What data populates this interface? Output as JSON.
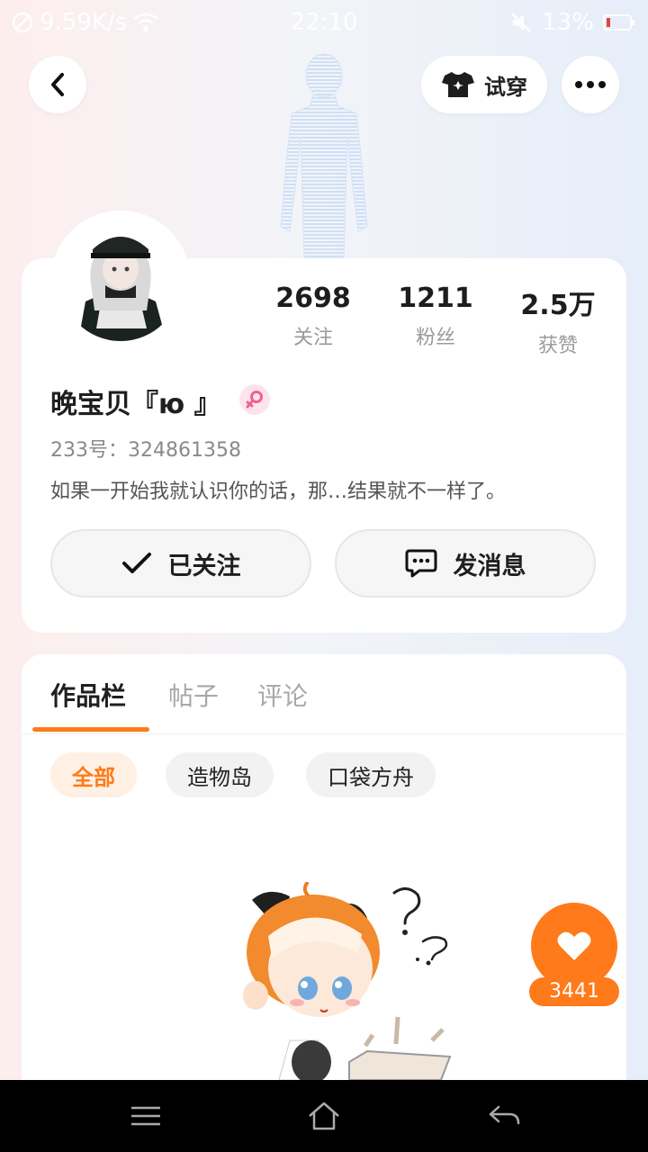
{
  "status_bar": {
    "net_speed": "9.59K/s",
    "time": "22:10",
    "battery": "13%"
  },
  "header": {
    "try_on_label": "试穿"
  },
  "profile": {
    "stats": [
      {
        "value": "2698",
        "label": "关注"
      },
      {
        "value": "1211",
        "label": "粉丝"
      },
      {
        "value": "2.5万",
        "label": "获赞"
      }
    ],
    "username": "晚宝贝『ю 』",
    "uid": "233号：324861358",
    "bio": "如果一开始我就认识你的话，那…结果就不一样了。",
    "follow_label": "已关注",
    "message_label": "发消息"
  },
  "tabs": [
    {
      "label": "作品栏",
      "active": true
    },
    {
      "label": "帖子",
      "active": false
    },
    {
      "label": "评论",
      "active": false
    }
  ],
  "filters": [
    {
      "label": "全部",
      "active": true
    },
    {
      "label": "造物岛",
      "active": false
    },
    {
      "label": "口袋方舟",
      "active": false
    }
  ],
  "like_fab": {
    "count": "3441"
  },
  "colors": {
    "accent": "#ff7a1a",
    "gender_badge": "#f06292"
  }
}
